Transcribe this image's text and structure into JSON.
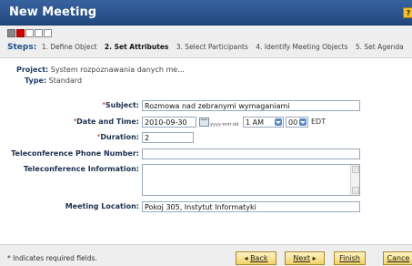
{
  "window": {
    "title": "New Meeting",
    "help_label": "?"
  },
  "progress": {
    "total_steps": 5,
    "current_step": 2
  },
  "steps": {
    "label": "Steps:",
    "items": [
      "1. Define Object",
      "2. Set Attributes",
      "3. Select Participants",
      "4. Identify Meeting Objects",
      "5. Set Agenda"
    ],
    "current_index": 1
  },
  "summary": {
    "project_label": "Project:",
    "project_value": "System rozpoznawania danych me...",
    "type_label": "Type:",
    "type_value": "Standard"
  },
  "form": {
    "required_mark": "*",
    "subject": {
      "label": "Subject:",
      "value": "Rozmowa nad zebranymi wymaganiami"
    },
    "datetime": {
      "label": "Date and Time:",
      "date": "2010-09-30",
      "format_hint": "yyyy-mm-dd",
      "hour": "1 AM",
      "minute": "00",
      "timezone": "EDT"
    },
    "duration": {
      "label": "Duration:",
      "value": "2"
    },
    "tele_phone": {
      "label": "Teleconference Phone Number:",
      "value": ""
    },
    "tele_info": {
      "label": "Teleconference Information:",
      "value": ""
    },
    "location": {
      "label": "Meeting Location:",
      "value": "Pokoj 305, Instytut Informatyki"
    }
  },
  "footer": {
    "note": "* Indicates required fields.",
    "back_label": "Back",
    "next_label": "Next",
    "finish_label": "Finish",
    "cancel_label": "Cance"
  },
  "colors": {
    "titlebar": "#2f5894",
    "active_step": "#d40000",
    "required": "#c00000",
    "button": "#f2d36b"
  }
}
